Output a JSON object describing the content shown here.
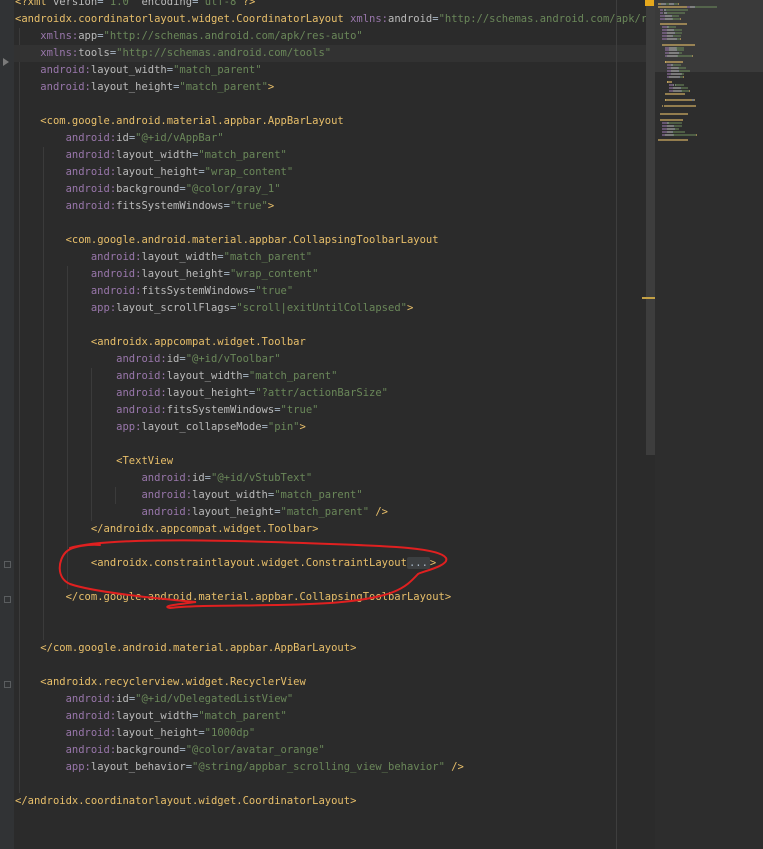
{
  "editor": {
    "lines": [
      {
        "segs": [
          [
            "t-pun",
            "<?"
          ],
          [
            "t-tag",
            "xml "
          ],
          [
            "t-attr",
            "version"
          ],
          [
            "t-plain",
            "="
          ],
          [
            "t-str",
            "\"1.0\" "
          ],
          [
            "t-attr",
            "encoding"
          ],
          [
            "t-plain",
            "="
          ],
          [
            "t-str",
            "\"utf-8\""
          ],
          [
            "t-pun",
            "?>"
          ]
        ]
      },
      {
        "segs": [
          [
            "t-pun",
            "<"
          ],
          [
            "t-tag",
            "androidx.coordinatorlayout.widget.CoordinatorLayout "
          ],
          [
            "t-ns",
            "xmlns:"
          ],
          [
            "t-attr",
            "android"
          ],
          [
            "t-plain",
            "="
          ],
          [
            "t-str",
            "\"http://schemas.android.com/apk/res/andr"
          ]
        ]
      },
      {
        "segs": [
          [
            "t-plain",
            "    "
          ],
          [
            "t-ns",
            "xmlns:"
          ],
          [
            "t-attr",
            "app"
          ],
          [
            "t-plain",
            "="
          ],
          [
            "t-str",
            "\"http://schemas.android.com/apk/res-auto\""
          ]
        ]
      },
      {
        "segs": [
          [
            "t-plain",
            "    "
          ],
          [
            "t-ns",
            "xmlns:"
          ],
          [
            "t-attr",
            "tools"
          ],
          [
            "t-plain",
            "="
          ],
          [
            "t-str",
            "\"http://schemas.android.com/tools\""
          ]
        ]
      },
      {
        "segs": [
          [
            "t-plain",
            "    "
          ],
          [
            "t-ns",
            "android:"
          ],
          [
            "t-attr",
            "layout_width"
          ],
          [
            "t-plain",
            "="
          ],
          [
            "t-str",
            "\"match_parent\""
          ]
        ]
      },
      {
        "segs": [
          [
            "t-plain",
            "    "
          ],
          [
            "t-ns",
            "android:"
          ],
          [
            "t-attr",
            "layout_height"
          ],
          [
            "t-plain",
            "="
          ],
          [
            "t-str",
            "\"match_parent\""
          ],
          [
            "t-pun",
            ">"
          ]
        ]
      },
      {
        "segs": []
      },
      {
        "segs": [
          [
            "t-plain",
            "    "
          ],
          [
            "t-pun",
            "<"
          ],
          [
            "t-tag",
            "com.google.android.material.appbar.AppBarLayout"
          ]
        ]
      },
      {
        "segs": [
          [
            "t-plain",
            "        "
          ],
          [
            "t-ns",
            "android:"
          ],
          [
            "t-attr",
            "id"
          ],
          [
            "t-plain",
            "="
          ],
          [
            "t-str",
            "\"@+id/vAppBar\""
          ]
        ]
      },
      {
        "segs": [
          [
            "t-plain",
            "        "
          ],
          [
            "t-ns",
            "android:"
          ],
          [
            "t-attr",
            "layout_width"
          ],
          [
            "t-plain",
            "="
          ],
          [
            "t-str",
            "\"match_parent\""
          ]
        ]
      },
      {
        "segs": [
          [
            "t-plain",
            "        "
          ],
          [
            "t-ns",
            "android:"
          ],
          [
            "t-attr",
            "layout_height"
          ],
          [
            "t-plain",
            "="
          ],
          [
            "t-str",
            "\"wrap_content\""
          ]
        ]
      },
      {
        "segs": [
          [
            "t-plain",
            "        "
          ],
          [
            "t-ns",
            "android:"
          ],
          [
            "t-attr",
            "background"
          ],
          [
            "t-plain",
            "="
          ],
          [
            "t-str",
            "\"@color/gray_1\""
          ]
        ]
      },
      {
        "segs": [
          [
            "t-plain",
            "        "
          ],
          [
            "t-ns",
            "android:"
          ],
          [
            "t-attr",
            "fitsSystemWindows"
          ],
          [
            "t-plain",
            "="
          ],
          [
            "t-str",
            "\"true\""
          ],
          [
            "t-pun",
            ">"
          ]
        ]
      },
      {
        "segs": []
      },
      {
        "segs": [
          [
            "t-plain",
            "        "
          ],
          [
            "t-pun",
            "<"
          ],
          [
            "t-tag",
            "com.google.android.material.appbar.CollapsingToolbarLayout"
          ]
        ]
      },
      {
        "segs": [
          [
            "t-plain",
            "            "
          ],
          [
            "t-ns",
            "android:"
          ],
          [
            "t-attr",
            "layout_width"
          ],
          [
            "t-plain",
            "="
          ],
          [
            "t-str",
            "\"match_parent\""
          ]
        ]
      },
      {
        "segs": [
          [
            "t-plain",
            "            "
          ],
          [
            "t-ns",
            "android:"
          ],
          [
            "t-attr",
            "layout_height"
          ],
          [
            "t-plain",
            "="
          ],
          [
            "t-str",
            "\"wrap_content\""
          ]
        ]
      },
      {
        "segs": [
          [
            "t-plain",
            "            "
          ],
          [
            "t-ns",
            "android:"
          ],
          [
            "t-attr",
            "fitsSystemWindows"
          ],
          [
            "t-plain",
            "="
          ],
          [
            "t-str",
            "\"true\""
          ]
        ]
      },
      {
        "segs": [
          [
            "t-plain",
            "            "
          ],
          [
            "t-ns",
            "app:"
          ],
          [
            "t-attr",
            "layout_scrollFlags"
          ],
          [
            "t-plain",
            "="
          ],
          [
            "t-str",
            "\"scroll|exitUntilCollapsed\""
          ],
          [
            "t-pun",
            ">"
          ]
        ]
      },
      {
        "segs": []
      },
      {
        "segs": [
          [
            "t-plain",
            "            "
          ],
          [
            "t-pun",
            "<"
          ],
          [
            "t-tag",
            "androidx.appcompat.widget.Toolbar"
          ]
        ]
      },
      {
        "segs": [
          [
            "t-plain",
            "                "
          ],
          [
            "t-ns",
            "android:"
          ],
          [
            "t-attr",
            "id"
          ],
          [
            "t-plain",
            "="
          ],
          [
            "t-str",
            "\"@+id/vToolbar\""
          ]
        ]
      },
      {
        "segs": [
          [
            "t-plain",
            "                "
          ],
          [
            "t-ns",
            "android:"
          ],
          [
            "t-attr",
            "layout_width"
          ],
          [
            "t-plain",
            "="
          ],
          [
            "t-str",
            "\"match_parent\""
          ]
        ]
      },
      {
        "segs": [
          [
            "t-plain",
            "                "
          ],
          [
            "t-ns",
            "android:"
          ],
          [
            "t-attr",
            "layout_height"
          ],
          [
            "t-plain",
            "="
          ],
          [
            "t-str",
            "\"?attr/actionBarSize\""
          ]
        ]
      },
      {
        "segs": [
          [
            "t-plain",
            "                "
          ],
          [
            "t-ns",
            "android:"
          ],
          [
            "t-attr",
            "fitsSystemWindows"
          ],
          [
            "t-plain",
            "="
          ],
          [
            "t-str",
            "\"true\""
          ]
        ]
      },
      {
        "segs": [
          [
            "t-plain",
            "                "
          ],
          [
            "t-ns",
            "app:"
          ],
          [
            "t-attr",
            "layout_collapseMode"
          ],
          [
            "t-plain",
            "="
          ],
          [
            "t-str",
            "\"pin\""
          ],
          [
            "t-pun",
            ">"
          ]
        ]
      },
      {
        "segs": []
      },
      {
        "segs": [
          [
            "t-plain",
            "                "
          ],
          [
            "t-pun",
            "<"
          ],
          [
            "t-tag",
            "TextView"
          ]
        ]
      },
      {
        "segs": [
          [
            "t-plain",
            "                    "
          ],
          [
            "t-ns",
            "android:"
          ],
          [
            "t-attr",
            "id"
          ],
          [
            "t-plain",
            "="
          ],
          [
            "t-str",
            "\"@+id/vStubText\""
          ]
        ]
      },
      {
        "segs": [
          [
            "t-plain",
            "                    "
          ],
          [
            "t-ns",
            "android:"
          ],
          [
            "t-attr",
            "layout_width"
          ],
          [
            "t-plain",
            "="
          ],
          [
            "t-str",
            "\"match_parent\""
          ]
        ]
      },
      {
        "segs": [
          [
            "t-plain",
            "                    "
          ],
          [
            "t-ns",
            "android:"
          ],
          [
            "t-attr",
            "layout_height"
          ],
          [
            "t-plain",
            "="
          ],
          [
            "t-str",
            "\"match_parent\" "
          ],
          [
            "t-pun",
            "/>"
          ]
        ]
      },
      {
        "segs": [
          [
            "t-plain",
            "            "
          ],
          [
            "t-pun",
            "</"
          ],
          [
            "t-tag",
            "androidx.appcompat.widget.Toolbar"
          ],
          [
            "t-pun",
            ">"
          ]
        ]
      },
      {
        "segs": []
      },
      {
        "segs": [
          [
            "t-plain",
            "            "
          ],
          [
            "t-pun",
            "<"
          ],
          [
            "t-tag",
            "androidx.constraintlayout.widget.ConstraintLayout"
          ],
          [
            "fold-marker",
            "..."
          ],
          [
            "t-pun",
            ">"
          ]
        ]
      },
      {
        "segs": []
      },
      {
        "segs": [
          [
            "t-plain",
            "        "
          ],
          [
            "t-pun",
            "</"
          ],
          [
            "t-tag",
            "com.google.android.material.appbar.CollapsingToolbarLayout"
          ],
          [
            "t-pun",
            ">"
          ]
        ]
      },
      {
        "segs": []
      },
      {
        "segs": []
      },
      {
        "segs": [
          [
            "t-plain",
            "    "
          ],
          [
            "t-pun",
            "</"
          ],
          [
            "t-tag",
            "com.google.android.material.appbar.AppBarLayout"
          ],
          [
            "t-pun",
            ">"
          ]
        ]
      },
      {
        "segs": []
      },
      {
        "segs": [
          [
            "t-plain",
            "    "
          ],
          [
            "t-pun",
            "<"
          ],
          [
            "t-tag",
            "androidx.recyclerview.widget.RecyclerView"
          ]
        ]
      },
      {
        "segs": [
          [
            "t-plain",
            "        "
          ],
          [
            "t-ns",
            "android:"
          ],
          [
            "t-attr",
            "id"
          ],
          [
            "t-plain",
            "="
          ],
          [
            "t-str",
            "\"@+id/vDelegatedListView\""
          ]
        ]
      },
      {
        "segs": [
          [
            "t-plain",
            "        "
          ],
          [
            "t-ns",
            "android:"
          ],
          [
            "t-attr",
            "layout_width"
          ],
          [
            "t-plain",
            "="
          ],
          [
            "t-str",
            "\"match_parent\""
          ]
        ]
      },
      {
        "segs": [
          [
            "t-plain",
            "        "
          ],
          [
            "t-ns",
            "android:"
          ],
          [
            "t-attr",
            "layout_height"
          ],
          [
            "t-plain",
            "="
          ],
          [
            "t-str",
            "\"1000dp\""
          ]
        ]
      },
      {
        "segs": [
          [
            "t-plain",
            "        "
          ],
          [
            "t-ns",
            "android:"
          ],
          [
            "t-attr",
            "background"
          ],
          [
            "t-plain",
            "="
          ],
          [
            "t-str",
            "\"@color/avatar_orange\""
          ]
        ]
      },
      {
        "segs": [
          [
            "t-plain",
            "        "
          ],
          [
            "t-ns",
            "app:"
          ],
          [
            "t-attr",
            "layout_behavior"
          ],
          [
            "t-plain",
            "="
          ],
          [
            "t-str",
            "\"@string/appbar_scrolling_view_behavior\" "
          ],
          [
            "t-pun",
            "/>"
          ]
        ]
      },
      {
        "segs": []
      },
      {
        "segs": [
          [
            "t-pun",
            "</"
          ],
          [
            "t-tag",
            "androidx.coordinatorlayout.widget.CoordinatorLayout"
          ],
          [
            "t-pun",
            ">"
          ]
        ]
      }
    ],
    "highlighted_line": 3,
    "fold_lines": [
      33
    ]
  },
  "colors": {
    "background": "#2b2b2b",
    "tag": "#e8bf6a",
    "namespace": "#9876aa",
    "attribute": "#bababa",
    "string": "#6a8759",
    "annotation": "#e02020"
  }
}
